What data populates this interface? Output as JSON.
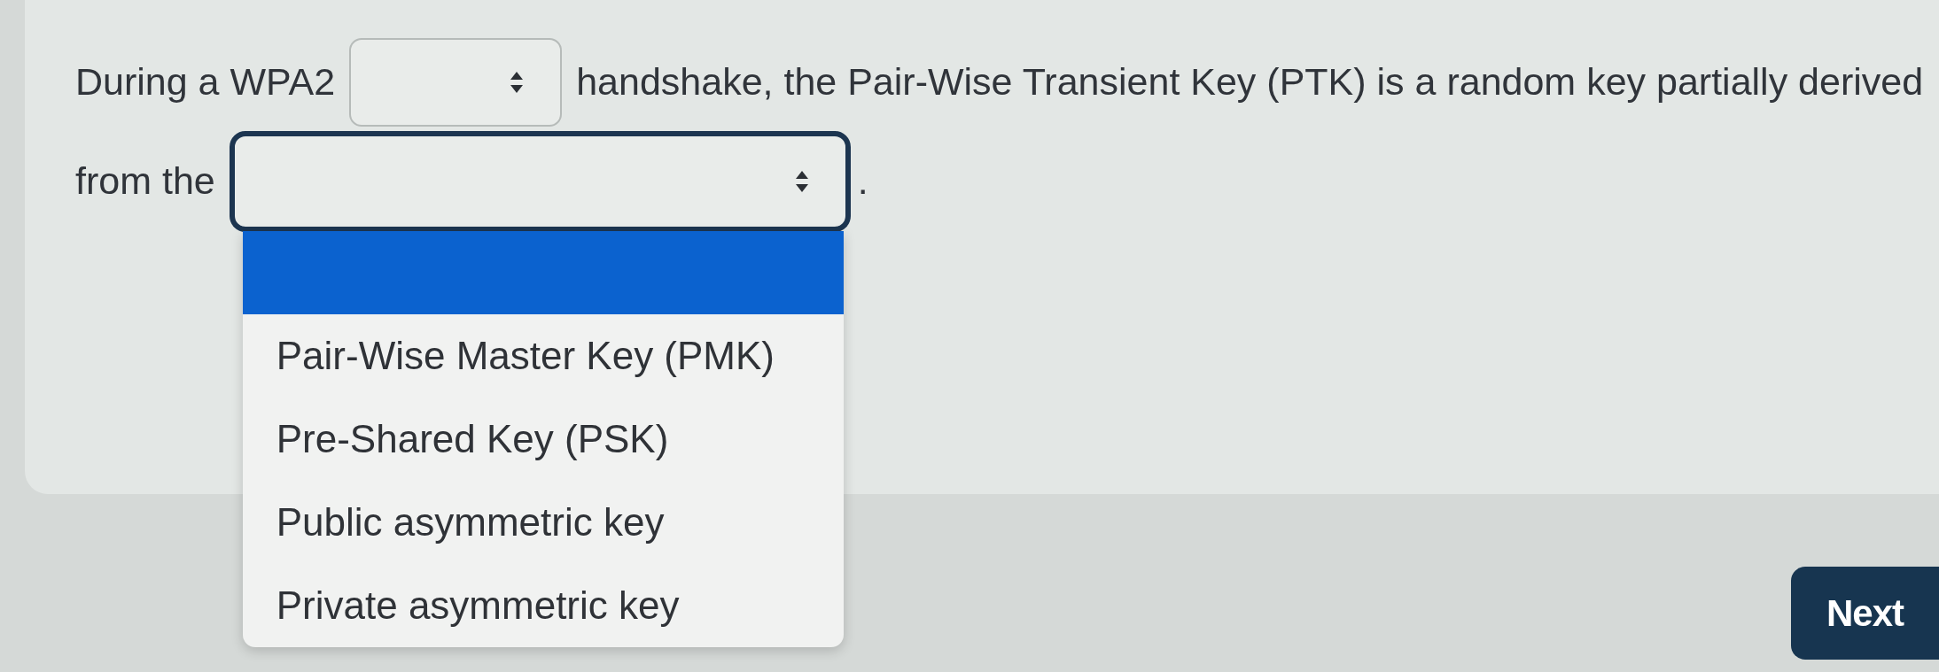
{
  "question": {
    "lines": [
      {
        "segments": [
          {
            "kind": "text",
            "text": "During a WPA2"
          },
          {
            "kind": "select",
            "expanded": false
          },
          {
            "kind": "text",
            "text": "handshake, the Pair-Wise Transient Key (PTK) is a random key partially derived"
          }
        ]
      },
      {
        "segments": [
          {
            "kind": "text",
            "text": "from the"
          },
          {
            "kind": "select",
            "expanded": true,
            "options": [
              {
                "selected": true
              },
              {
                "label": "Pair-Wise Master Key (PMK)",
                "selected": false
              },
              {
                "label": "Pre-Shared Key (PSK)",
                "selected": false
              },
              {
                "label": "Public asymmetric key",
                "selected": false
              },
              {
                "label": "Private asymmetric key",
                "selected": false
              }
            ]
          },
          {
            "kind": "text",
            "text": "."
          }
        ]
      }
    ]
  },
  "next_button": {
    "label": "Next"
  }
}
